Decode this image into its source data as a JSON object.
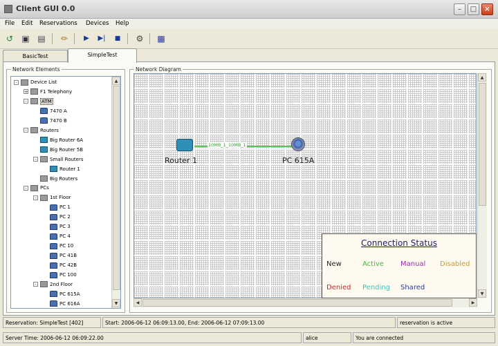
{
  "window": {
    "title": "Client GUI 0.0"
  },
  "menu": [
    "File",
    "Edit",
    "Reservations",
    "Devices",
    "Help"
  ],
  "toolbar": {
    "icons": [
      "connect-icon",
      "save-icon",
      "save-all-icon",
      "pencil-icon",
      "play-icon",
      "step-icon",
      "stop-icon",
      "network-tool-icon",
      "bar-chart-icon"
    ]
  },
  "tabs": [
    {
      "label": "BasicTest",
      "active": false
    },
    {
      "label": "SimpleTest",
      "active": true
    }
  ],
  "left_panel": {
    "label": "Network Elements",
    "tree": [
      {
        "label": "Device List",
        "expander": "-",
        "icon": "folder-icon"
      },
      {
        "label": "F1 Telephony",
        "expander": "+",
        "icon": "folder-icon"
      },
      {
        "label": "ATM",
        "expander": "-",
        "icon": "folder-icon",
        "selected": true
      },
      {
        "label": "7470 A",
        "icon": "pc-icon"
      },
      {
        "label": "7470 B",
        "icon": "pc-icon"
      },
      {
        "label": "Routers",
        "expander": "-",
        "icon": "folder-icon"
      },
      {
        "label": "Big Router 6A",
        "icon": "router-icon"
      },
      {
        "label": "Big Router 5B",
        "icon": "router-icon"
      },
      {
        "label": "Small Routers",
        "expander": "-",
        "icon": "folder-icon"
      },
      {
        "label": "Router 1",
        "icon": "router-icon"
      },
      {
        "label": "Big Routers",
        "icon": "folder-icon"
      },
      {
        "label": "PCs",
        "expander": "-",
        "icon": "folder-icon"
      },
      {
        "label": "1st Floor",
        "expander": "-",
        "icon": "folder-icon"
      },
      {
        "label": "PC 1",
        "icon": "pc-icon"
      },
      {
        "label": "PC 2",
        "icon": "pc-icon"
      },
      {
        "label": "PC 3",
        "icon": "pc-icon"
      },
      {
        "label": "PC 4",
        "icon": "pc-icon"
      },
      {
        "label": "PC 10",
        "icon": "pc-icon"
      },
      {
        "label": "PC 41B",
        "icon": "pc-icon"
      },
      {
        "label": "PC 42B",
        "icon": "pc-icon"
      },
      {
        "label": "PC 100",
        "icon": "pc-icon"
      },
      {
        "label": "2nd Floor",
        "expander": "-",
        "icon": "folder-icon"
      },
      {
        "label": "PC 615A",
        "icon": "pc-icon"
      },
      {
        "label": "PC 616A",
        "icon": "pc-icon"
      }
    ]
  },
  "diagram": {
    "label": "Network Diagram",
    "nodes": [
      {
        "label": "Router 1",
        "icon": "router-icon"
      },
      {
        "label": "PC 615A",
        "icon": "pc-icon"
      }
    ],
    "link_label": "10MB_1_10MB_1",
    "link_color": "#58c858",
    "legend": {
      "title": "Connection Status",
      "items": [
        {
          "label": "New",
          "color": "#222222"
        },
        {
          "label": "Active",
          "color": "#3cbf3c"
        },
        {
          "label": "Manual",
          "color": "#9a2ab0"
        },
        {
          "label": "Disabled",
          "color": "#c89a3c"
        },
        {
          "label": "Denied",
          "color": "#c82a2a"
        },
        {
          "label": "Pending",
          "color": "#3cc0c0"
        },
        {
          "label": "Shared",
          "color": "#2a3a9a"
        }
      ]
    }
  },
  "status": {
    "reservation": "Reservation: SimpleTest [402]",
    "times": "Start: 2006-06-12 06:09:13.00,  End: 2006-06-12 07:09:13.00",
    "reservation_state": "reservation is active",
    "server_time": "Server Time: 2006-06-12 06:09:22.00",
    "user": "alice",
    "connection": "You are connected"
  }
}
